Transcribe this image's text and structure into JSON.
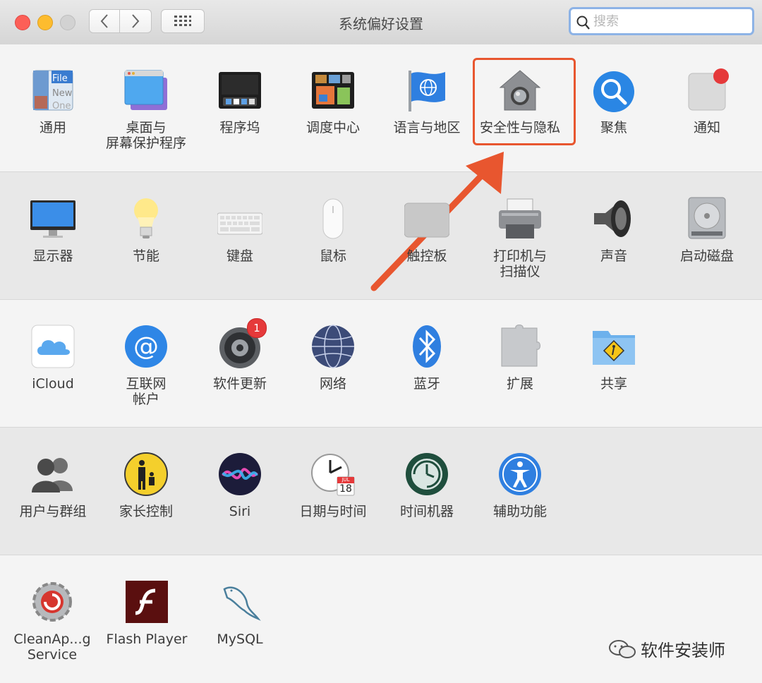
{
  "window": {
    "title": "系统偏好设置",
    "search_placeholder": "搜索"
  },
  "rows": [
    {
      "items": [
        {
          "label": "通用",
          "icon": "general-icon"
        },
        {
          "label": "桌面与\n屏幕保护程序",
          "icon": "desktop-icon"
        },
        {
          "label": "程序坞",
          "icon": "dock-icon"
        },
        {
          "label": "调度中心",
          "icon": "mission-control-icon"
        },
        {
          "label": "语言与地区",
          "icon": "language-region-icon"
        },
        {
          "label": "安全性与隐私",
          "icon": "security-privacy-icon"
        },
        {
          "label": "聚焦",
          "icon": "spotlight-icon"
        },
        {
          "label": "通知",
          "icon": "notifications-icon"
        }
      ]
    },
    {
      "items": [
        {
          "label": "显示器",
          "icon": "displays-icon"
        },
        {
          "label": "节能",
          "icon": "energy-saver-icon"
        },
        {
          "label": "键盘",
          "icon": "keyboard-icon"
        },
        {
          "label": "鼠标",
          "icon": "mouse-icon"
        },
        {
          "label": "触控板",
          "icon": "trackpad-icon"
        },
        {
          "label": "打印机与\n扫描仪",
          "icon": "printer-icon"
        },
        {
          "label": "声音",
          "icon": "sound-icon"
        },
        {
          "label": "启动磁盘",
          "icon": "startup-disk-icon"
        }
      ]
    },
    {
      "items": [
        {
          "label": "iCloud",
          "icon": "icloud-icon"
        },
        {
          "label": "互联网\n帐户",
          "icon": "internet-accounts-icon"
        },
        {
          "label": "软件更新",
          "icon": "software-update-icon",
          "badge": "1"
        },
        {
          "label": "网络",
          "icon": "network-icon"
        },
        {
          "label": "蓝牙",
          "icon": "bluetooth-icon"
        },
        {
          "label": "扩展",
          "icon": "extensions-icon"
        },
        {
          "label": "共享",
          "icon": "sharing-icon"
        }
      ]
    },
    {
      "items": [
        {
          "label": "用户与群组",
          "icon": "users-groups-icon"
        },
        {
          "label": "家长控制",
          "icon": "parental-controls-icon"
        },
        {
          "label": "Siri",
          "icon": "siri-icon"
        },
        {
          "label": "日期与时间",
          "icon": "date-time-icon",
          "calendar_month": "JUL",
          "calendar_day": "18"
        },
        {
          "label": "时间机器",
          "icon": "time-machine-icon"
        },
        {
          "label": "辅助功能",
          "icon": "accessibility-icon"
        }
      ]
    },
    {
      "items": [
        {
          "label": "CleanAp...g Service",
          "icon": "cleanapp-icon"
        },
        {
          "label": "Flash Player",
          "icon": "flash-player-icon"
        },
        {
          "label": "MySQL",
          "icon": "mysql-icon"
        }
      ]
    }
  ],
  "general_icon_text": [
    "File",
    "New",
    "One"
  ],
  "notification_badge_color": "#e5393a",
  "annotation": {
    "color": "#e8562f",
    "target": "安全性与隐私"
  },
  "watermark": {
    "text": "软件安装师"
  }
}
